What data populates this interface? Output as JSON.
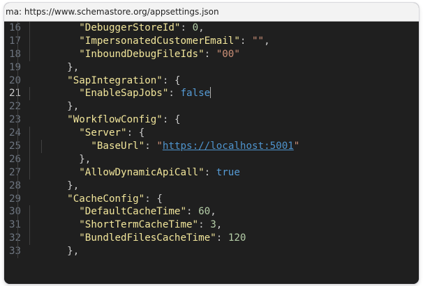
{
  "schema_bar": {
    "text": "ma:  https://www.schemastore.org/appsettings.json"
  },
  "editor": {
    "current_line": 21,
    "lines": [
      {
        "num": "16",
        "indent": "      ",
        "key": "\"DebuggerStoreId\"",
        "sep": ": ",
        "value": "0",
        "vtype": "num",
        "after": ","
      },
      {
        "num": "17",
        "indent": "      ",
        "key": "\"ImpersonatedCustomerEmail\"",
        "sep": ": ",
        "value": "\"\"",
        "vtype": "str",
        "after": ","
      },
      {
        "num": "18",
        "indent": "      ",
        "key": "\"InboundDebugFileIds\"",
        "sep": ": ",
        "value": "\"00\"",
        "vtype": "str",
        "after": ""
      },
      {
        "num": "19",
        "indent": "    ",
        "key": "",
        "sep": "",
        "value": "",
        "vtype": "",
        "after": "},"
      },
      {
        "num": "20",
        "indent": "    ",
        "key": "\"SapIntegration\"",
        "sep": ": ",
        "value": "",
        "vtype": "",
        "after": "{"
      },
      {
        "num": "21",
        "indent": "      ",
        "key": "\"EnableSapJobs\"",
        "sep": ": ",
        "value": "false",
        "vtype": "bool",
        "after": ""
      },
      {
        "num": "22",
        "indent": "    ",
        "key": "",
        "sep": "",
        "value": "",
        "vtype": "",
        "after": "},"
      },
      {
        "num": "23",
        "indent": "    ",
        "key": "\"WorkflowConfig\"",
        "sep": ": ",
        "value": "",
        "vtype": "",
        "after": "{"
      },
      {
        "num": "24",
        "indent": "      ",
        "key": "\"Server\"",
        "sep": ": ",
        "value": "",
        "vtype": "",
        "after": "{"
      },
      {
        "num": "25",
        "indent": "        ",
        "key": "\"BaseUrl\"",
        "sep": ": ",
        "value": "https://localhost:5001",
        "vtype": "link",
        "after": ""
      },
      {
        "num": "26",
        "indent": "      ",
        "key": "",
        "sep": "",
        "value": "",
        "vtype": "",
        "after": "},"
      },
      {
        "num": "27",
        "indent": "      ",
        "key": "\"AllowDynamicApiCall\"",
        "sep": ": ",
        "value": "true",
        "vtype": "bool",
        "after": ""
      },
      {
        "num": "28",
        "indent": "    ",
        "key": "",
        "sep": "",
        "value": "",
        "vtype": "",
        "after": "},"
      },
      {
        "num": "29",
        "indent": "    ",
        "key": "\"CacheConfig\"",
        "sep": ": ",
        "value": "",
        "vtype": "",
        "after": "{"
      },
      {
        "num": "30",
        "indent": "      ",
        "key": "\"DefaultCacheTime\"",
        "sep": ": ",
        "value": "60",
        "vtype": "num",
        "after": ","
      },
      {
        "num": "31",
        "indent": "      ",
        "key": "\"ShortTermCacheTime\"",
        "sep": ": ",
        "value": "3",
        "vtype": "num",
        "after": ","
      },
      {
        "num": "32",
        "indent": "      ",
        "key": "\"BundledFilesCacheTime\"",
        "sep": ": ",
        "value": "120",
        "vtype": "num",
        "after": ""
      },
      {
        "num": "33",
        "indent": "    ",
        "key": "",
        "sep": "",
        "value": "",
        "vtype": "",
        "after": "},"
      }
    ]
  },
  "colors": {
    "editor_background": "#1f1f1f",
    "line_number": "#6e7681",
    "json_key": "#ffffaf",
    "string": "#ce9178",
    "number": "#b5cea8",
    "boolean": "#569cd6",
    "link": "#4e94ce"
  }
}
